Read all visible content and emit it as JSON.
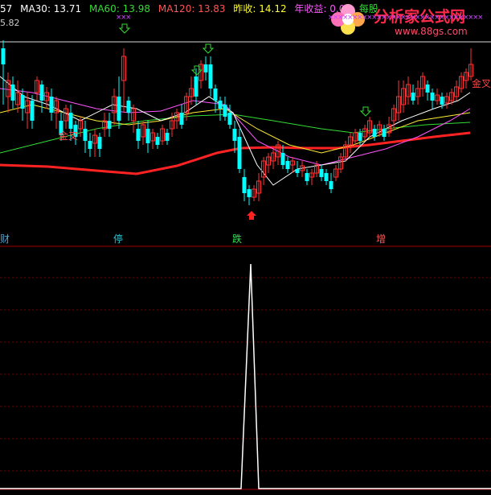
{
  "header": {
    "ma_partial": "57",
    "ma30": "MA30: 13.71",
    "ma60": "MA60: 13.98",
    "ma120": "MA120: 13.83",
    "prev_close": "昨收: 14.12",
    "annual_return": "年收益: 0.00",
    "per_share": "每股"
  },
  "price_label": "5.82",
  "signals": {
    "golden_cross": "金叉"
  },
  "tags": [
    {
      "text": "财",
      "color": "#4fa3d8"
    },
    {
      "text": "停",
      "color": "#27c8d8"
    },
    {
      "text": "跌",
      "color": "#33dd55"
    },
    {
      "text": "增",
      "color": "#ff5555"
    }
  ],
  "watermark": {
    "title": "分析家公式网",
    "url": "www.88gs.com"
  },
  "colors": {
    "up": "#ff3333",
    "down": "#00ffff",
    "ma30": "#ff55ff",
    "ma60": "#33dd33",
    "ma120": "#ff3333",
    "bg": "#000000"
  }
}
